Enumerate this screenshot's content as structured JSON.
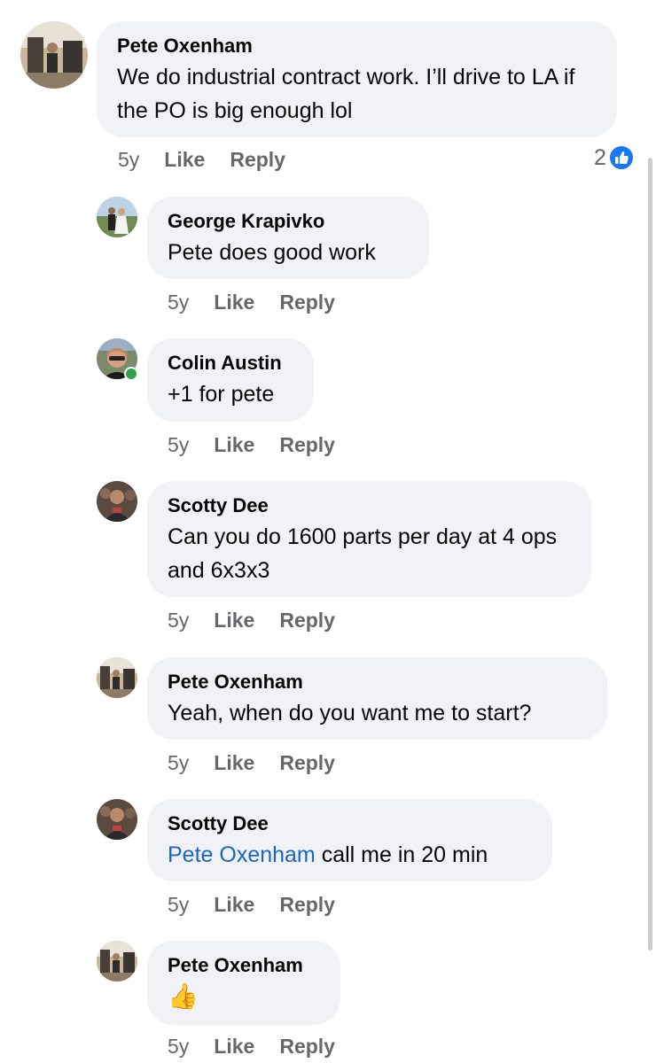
{
  "comments": [
    {
      "author": "Pete Oxenham",
      "text": "We do industrial contract work. I’ll drive to LA if the PO is big enough lol",
      "age": "5y",
      "like": "Like",
      "reply": "Reply",
      "reactions": {
        "count": "2",
        "icon": "like-icon"
      }
    },
    {
      "author": "George Krapivko",
      "text": "Pete does good work",
      "age": "5y",
      "like": "Like",
      "reply": "Reply"
    },
    {
      "author": "Colin Austin",
      "text": "+1 for pete",
      "age": "5y",
      "like": "Like",
      "reply": "Reply",
      "online": true
    },
    {
      "author": "Scotty Dee",
      "text": "Can you do 1600 parts per day at 4 ops and 6x3x3",
      "age": "5y",
      "like": "Like",
      "reply": "Reply"
    },
    {
      "author": "Pete Oxenham",
      "text": "Yeah, when do you want me to start?",
      "age": "5y",
      "like": "Like",
      "reply": "Reply"
    },
    {
      "author": "Scotty Dee",
      "mention": "Pete Oxenham",
      "text": " call me in 20 min",
      "age": "5y",
      "like": "Like",
      "reply": "Reply"
    },
    {
      "author": "Pete Oxenham",
      "text": "👍",
      "age": "5y",
      "like": "Like",
      "reply": "Reply"
    }
  ],
  "colors": {
    "bubble": "#f0f2f5",
    "meta": "#65676b",
    "mention": "#1a65c9",
    "like_badge": "#1877f2",
    "online": "#31a24c"
  }
}
